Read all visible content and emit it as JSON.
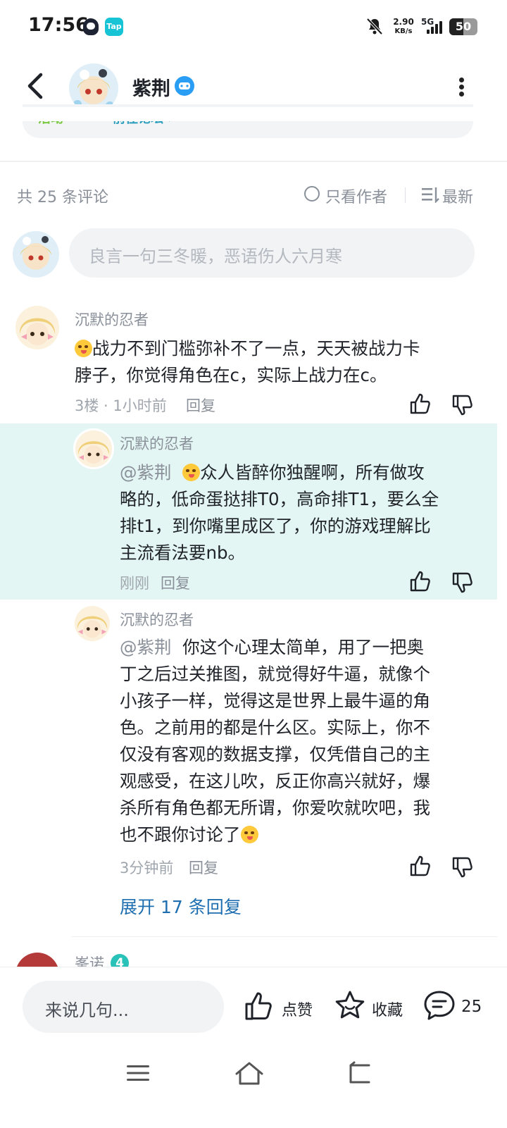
{
  "status_bar": {
    "time": "17:56",
    "tap_label": "Tap",
    "net_speed_value": "2.90",
    "net_speed_unit": "KB/s",
    "network": "5G",
    "battery": "50",
    "battery_level": 0.5
  },
  "header": {
    "author": "紫荆",
    "banner_tag": "活动",
    "banner_link": "前往论坛 ›"
  },
  "comments_toolbar": {
    "count_label": "共 25 条评论",
    "author_only": "只看作者",
    "sort": "最新"
  },
  "composer": {
    "placeholder": "良言一句三冬暖，恶语伤人六月寒"
  },
  "comments": [
    {
      "user": "沉默的忍者",
      "lines": [
        "战力不到门槛弥补不了一点，天天被战力卡",
        "脖子，你觉得角色在c，实际上战力在c。"
      ],
      "meta": "3楼 · 1小时前",
      "reply": "回复"
    },
    {
      "user": "沉默的忍者",
      "mention": "@紫荆",
      "lines": [
        "众人皆醉你独醒啊，所有做攻",
        "略的，低命蛋挞排T0，高命排T1，要么全",
        "排t1，到你嘴里成区了，你的游戏理解比",
        "主流看法要nb。"
      ],
      "meta": "刚刚",
      "reply": "回复"
    },
    {
      "user": "沉默的忍者",
      "mention": "@紫荆",
      "lines": [
        "你这个心理太简单，用了一把奥",
        "丁之后过关推图，就觉得好牛逼，就像个",
        "小孩子一样，觉得这是世界上最牛逼的角",
        "色。之前用的都是什么区。实际上，你不",
        "仅没有客观的数据支撑，仅凭借自己的主",
        "观感受，在这儿吹，反正你高兴就好，爆",
        "杀所有角色都无所谓，你爱吹就吹吧，我",
        "也不跟你讨论了"
      ],
      "meta": "3分钟前",
      "reply": "回复"
    }
  ],
  "expand_replies": "展开 17 条回复",
  "next_comment": {
    "user": "峯诺",
    "badge": "4"
  },
  "bottom_bar": {
    "input_placeholder": "来说几句...",
    "like_label": "点赞",
    "fav_label": "收藏",
    "comment_count": "25"
  }
}
